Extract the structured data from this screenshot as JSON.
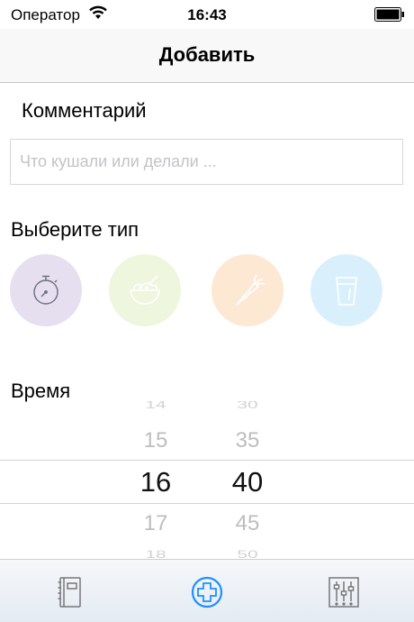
{
  "status_bar": {
    "carrier": "Оператор",
    "time": "16:43"
  },
  "nav": {
    "title": "Добавить"
  },
  "comment": {
    "label": "Комментарий",
    "placeholder": "Что кушали или делали ...",
    "value": ""
  },
  "type_section": {
    "label": "Выберите тип",
    "types": [
      {
        "icon": "stopwatch-icon",
        "color": "#e5dff0"
      },
      {
        "icon": "bowl-icon",
        "color": "#eef6dd"
      },
      {
        "icon": "carrot-icon",
        "color": "#fde8d4"
      },
      {
        "icon": "glass-icon",
        "color": "#d9f0fc"
      }
    ]
  },
  "time_section": {
    "label": "Время",
    "hours": [
      "14",
      "15",
      "16",
      "17",
      "18"
    ],
    "minutes": [
      "30",
      "35",
      "40",
      "45",
      "50"
    ],
    "selected_hour": "16",
    "selected_minute": "40"
  },
  "tab_bar": {
    "accent": "#1e90ff",
    "tabs": [
      {
        "icon": "notebook-icon",
        "active": false
      },
      {
        "icon": "add-circle-icon",
        "active": true
      },
      {
        "icon": "settings-sliders-icon",
        "active": false
      }
    ]
  }
}
